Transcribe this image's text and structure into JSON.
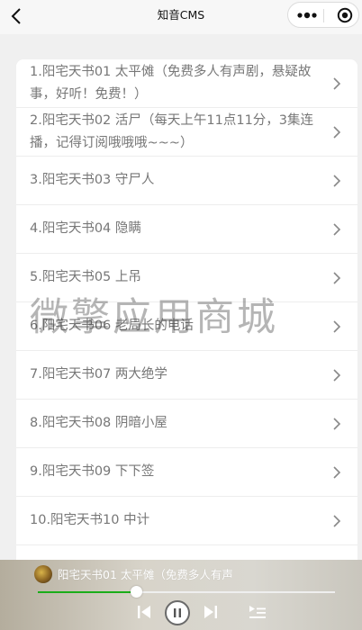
{
  "nav": {
    "title": "知音CMS"
  },
  "list": {
    "items": [
      "1.阳宅天书01 太平傩（免费多人有声剧，悬疑故事，好听！免费！）",
      "2.阳宅天书02 活尸（每天上午11点11分，3集连播，记得订阅哦哦哦~~~）",
      "3.阳宅天书03 守尸人",
      "4.阳宅天书04 隐瞒",
      "5.阳宅天书05 上吊",
      "6.阳宅天书06 老局长的电话",
      "7.阳宅天书07 两大绝学",
      "8.阳宅天书08 阴暗小屋",
      "9.阳宅天书09 下下签",
      "10.阳宅天书10 中计"
    ]
  },
  "watermark": "微擎应用商城",
  "player": {
    "title": "阳宅天书01 太平傩（免费多人有声",
    "progress": 0.33,
    "accent": "#1aad19"
  }
}
